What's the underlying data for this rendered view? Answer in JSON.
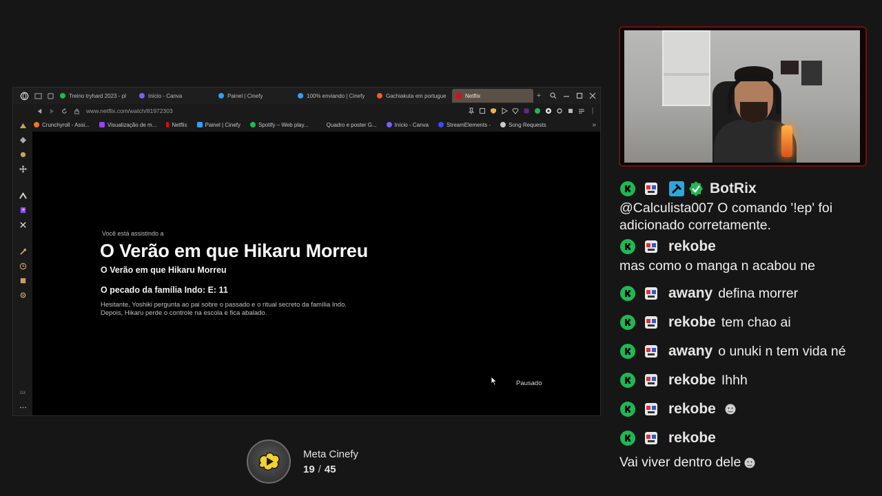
{
  "browser": {
    "tabs": [
      {
        "label": "Treino tryhard 2023 - pl",
        "color": "#1db954"
      },
      {
        "label": "Início - Canva",
        "color": "#7d5cff"
      },
      {
        "label": "Painel | Cinefy",
        "color": "#29a3ff"
      },
      {
        "label": "100% enviando | Cinefy",
        "color": "#29a3ff"
      },
      {
        "label": "Gachiakuta em portugue",
        "color": "#ff5a1f"
      },
      {
        "label": "Netflix",
        "color": "#e50914",
        "active": true
      }
    ],
    "url": "www.netflix.com/watch/81972303",
    "bookmarks": [
      {
        "label": "Crunchyroll - Assi...",
        "color": "#f47521"
      },
      {
        "label": "Visualização de m...",
        "color": "#9146ff"
      },
      {
        "label": "Netflix",
        "color": "#e50914"
      },
      {
        "label": "Painel | Cinefy",
        "color": "#29a3ff"
      },
      {
        "label": "Spotify – Web play...",
        "color": "#1db954"
      },
      {
        "label": "Quadro e poster G...",
        "color": "#1a1a1a"
      },
      {
        "label": "Início - Canva",
        "color": "#7d5cff"
      },
      {
        "label": "StreamElements -",
        "color": "#3b4bff"
      },
      {
        "label": "Song Requests",
        "color": "#cccccc"
      }
    ],
    "sidebar_bottom_label": "GX"
  },
  "player": {
    "watching_label": "Você está assistindo a",
    "title": "O Verão em que Hikaru Morreu",
    "subtitle": "O Verão em que Hikaru Morreu",
    "episode": "O pecado da família Indo: E: 11",
    "synopsis": "Hesitante, Yoshiki pergunta ao pai sobre o passado e o ritual secreto da família Indo. Depois, Hikaru perde o controle na escola e fica abalado.",
    "status": "Pausado"
  },
  "meta": {
    "title": "Meta Cinefy",
    "current": "19",
    "separator": "/",
    "total": "45"
  },
  "chat": {
    "messages": [
      {
        "user": "BotRix",
        "text": "",
        "extra_badges": true
      },
      {
        "user": "",
        "text": "@Calculista007 O comando '!ep' foi"
      },
      {
        "user": "",
        "text": "adicionado corretamente."
      },
      {
        "user": "rekobe",
        "text": ""
      },
      {
        "user": "",
        "text": "mas como o manga n acabou ne"
      },
      {
        "user": "awany",
        "text": "defina morrer"
      },
      {
        "user": "rekobe",
        "text": "tem chao ai"
      },
      {
        "user": "awany",
        "text": "o unuki n tem vida né"
      },
      {
        "user": "rekobe",
        "text": "Ihhh"
      },
      {
        "user": "rekobe",
        "text": "",
        "emoji": true
      },
      {
        "user": "rekobe",
        "text": ""
      },
      {
        "user": "",
        "text": "Vai viver dentro dele",
        "emoji": true
      }
    ]
  }
}
